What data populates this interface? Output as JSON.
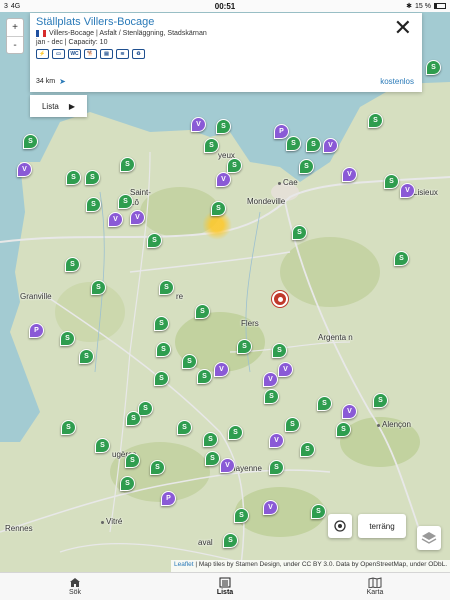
{
  "status_bar": {
    "signal": "3",
    "network": "4G",
    "time": "00:51",
    "battery_percent": "15 %",
    "battery_level": 0.15
  },
  "zoom": {
    "in_label": "+",
    "out_label": "-"
  },
  "card": {
    "title": "Ställplats Villers-Bocage",
    "subtitle": "Villers-Bocage | Asfalt / Stenläggning, Stadskärnan",
    "availability": "jan - dec | Capacity: 10",
    "amenities": [
      "power-icon",
      "shower-icon",
      "wc-icon",
      "dog-icon",
      "motorhome-icon",
      "wifi-icon",
      "recycle-icon"
    ],
    "amenity_labels": [
      "⚡",
      "▭",
      "WC",
      "🐕",
      "▤",
      "≋",
      "♻"
    ],
    "distance": "34 km",
    "price": "kostenlos",
    "close_label": "✕"
  },
  "lista_button": {
    "label": "Lista"
  },
  "places": [
    "Bayeux",
    "Caen",
    "Saint-Lô",
    "Mondeville",
    "Lisieux",
    "Granville",
    "Vire",
    "Flers",
    "Argentan",
    "Fougères",
    "Mayenne",
    "Alençon",
    "Vitré",
    "Rennes",
    "Laval"
  ],
  "place_labels": {
    "bayeux": "yeux",
    "caen": "Cae",
    "saint_lo": "Saint-\nLô",
    "mondeville": "Mondeville",
    "lisieux": "Lisieux",
    "granville": "Granville",
    "vire": "re",
    "flers": "Flers",
    "argentan": "Argenta n",
    "fougeres": "ugères",
    "mayenne": "Mayenne",
    "alencon": "Alençon",
    "vitre": "Vitré",
    "rennes": "Rennes",
    "laval": "aval"
  },
  "markers": {
    "legend": {
      "S": "S",
      "V": "V",
      "P": "P"
    }
  },
  "map_controls": {
    "terrain_label": "terräng"
  },
  "attribution": {
    "leaflet": "Leaflet",
    "text1": " | Map tiles by ",
    "stamen": "Stamen Design",
    "text2": ", under ",
    "ccby": "CC BY 3.0",
    "text3": ". Data by ",
    "osm": "OpenStreetMap",
    "text4": ", under ",
    "odbl": "ODbL",
    "text5": "."
  },
  "tabs": [
    {
      "label": "Sök",
      "icon": "home-icon"
    },
    {
      "label": "Lista",
      "icon": "list-icon"
    },
    {
      "label": "Karta",
      "icon": "map-icon"
    }
  ],
  "colors": {
    "accent": "#2a7ab8",
    "marker_s": "#2f9d4f",
    "marker_v": "#8a5ad6",
    "target": "#c0392b"
  }
}
